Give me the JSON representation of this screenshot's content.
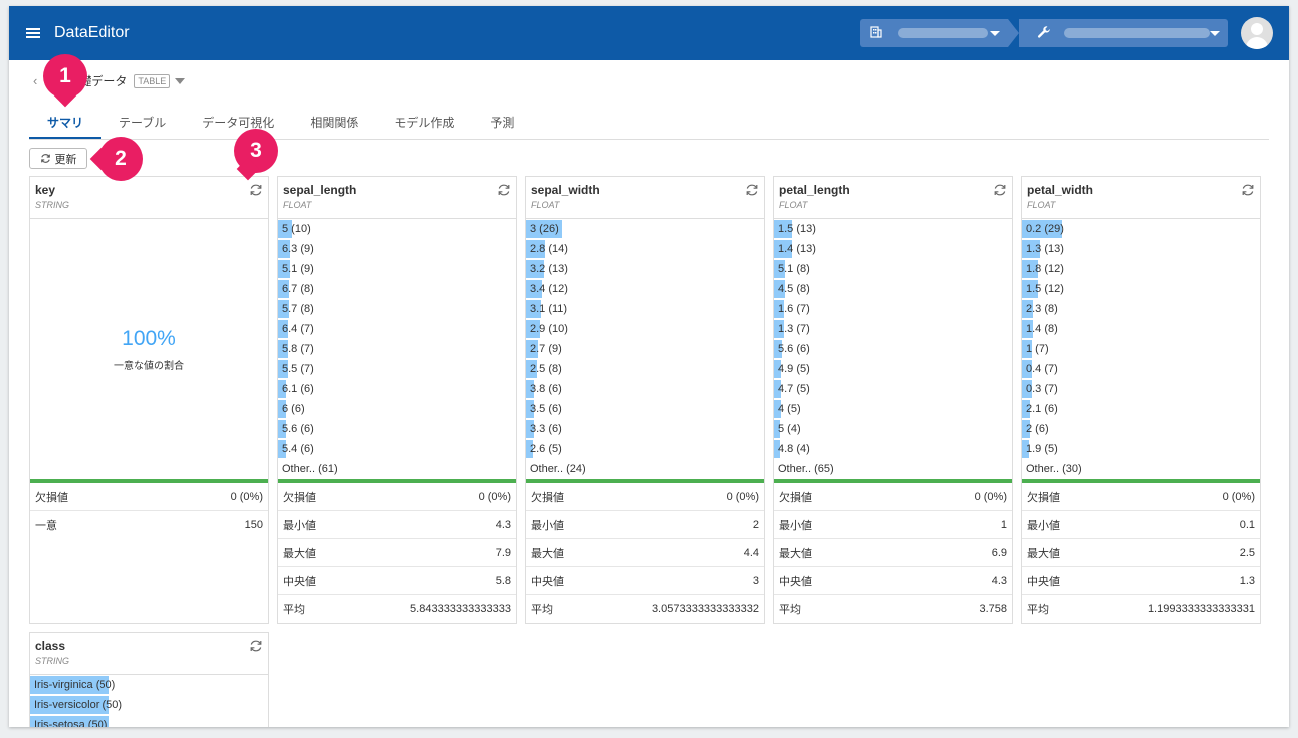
{
  "app": {
    "title": "DataEditor"
  },
  "breadcrumb": {
    "back": "‹",
    "table_name": "めの基礎データ",
    "badge": "TABLE"
  },
  "tabs": [
    "サマリ",
    "テーブル",
    "データ可視化",
    "相関関係",
    "モデル作成",
    "予測"
  ],
  "toolbar": {
    "refresh_label": "更新"
  },
  "markers": [
    "1",
    "2",
    "3"
  ],
  "key_card": {
    "name": "key",
    "type": "STRING",
    "unique_pct": "100%",
    "unique_label": "一意な値の割合",
    "stats": [
      {
        "label": "欠損値",
        "value": "0 (0%)"
      },
      {
        "label": "一意",
        "value": "150"
      }
    ]
  },
  "columns": [
    {
      "name": "sepal_length",
      "type": "FLOAT",
      "histogram": [
        {
          "label": "5 (10)",
          "frac": 0.34
        },
        {
          "label": "6.3 (9)",
          "frac": 0.31
        },
        {
          "label": "5.1 (9)",
          "frac": 0.31
        },
        {
          "label": "6.7 (8)",
          "frac": 0.28
        },
        {
          "label": "5.7 (8)",
          "frac": 0.28
        },
        {
          "label": "6.4 (7)",
          "frac": 0.24
        },
        {
          "label": "5.8 (7)",
          "frac": 0.24
        },
        {
          "label": "5.5 (7)",
          "frac": 0.24
        },
        {
          "label": "6.1 (6)",
          "frac": 0.21
        },
        {
          "label": "6 (6)",
          "frac": 0.21
        },
        {
          "label": "5.6 (6)",
          "frac": 0.21
        },
        {
          "label": "5.4 (6)",
          "frac": 0.21
        }
      ],
      "other": "Other.. (61)",
      "stats": [
        {
          "label": "欠損値",
          "value": "0 (0%)"
        },
        {
          "label": "最小値",
          "value": "4.3"
        },
        {
          "label": "最大値",
          "value": "7.9"
        },
        {
          "label": "中央値",
          "value": "5.8"
        },
        {
          "label": "平均",
          "value": "5.843333333333333"
        }
      ]
    },
    {
      "name": "sepal_width",
      "type": "FLOAT",
      "histogram": [
        {
          "label": "3 (26)",
          "frac": 0.9
        },
        {
          "label": "2.8 (14)",
          "frac": 0.48
        },
        {
          "label": "3.2 (13)",
          "frac": 0.45
        },
        {
          "label": "3.4 (12)",
          "frac": 0.41
        },
        {
          "label": "3.1 (11)",
          "frac": 0.38
        },
        {
          "label": "2.9 (10)",
          "frac": 0.34
        },
        {
          "label": "2.7 (9)",
          "frac": 0.31
        },
        {
          "label": "2.5 (8)",
          "frac": 0.28
        },
        {
          "label": "3.8 (6)",
          "frac": 0.21
        },
        {
          "label": "3.5 (6)",
          "frac": 0.21
        },
        {
          "label": "3.3 (6)",
          "frac": 0.21
        },
        {
          "label": "2.6 (5)",
          "frac": 0.17
        }
      ],
      "other": "Other.. (24)",
      "stats": [
        {
          "label": "欠損値",
          "value": "0 (0%)"
        },
        {
          "label": "最小値",
          "value": "2"
        },
        {
          "label": "最大値",
          "value": "4.4"
        },
        {
          "label": "中央値",
          "value": "3"
        },
        {
          "label": "平均",
          "value": "3.0573333333333332"
        }
      ]
    },
    {
      "name": "petal_length",
      "type": "FLOAT",
      "histogram": [
        {
          "label": "1.5 (13)",
          "frac": 0.45
        },
        {
          "label": "1.4 (13)",
          "frac": 0.45
        },
        {
          "label": "5.1 (8)",
          "frac": 0.28
        },
        {
          "label": "4.5 (8)",
          "frac": 0.28
        },
        {
          "label": "1.6 (7)",
          "frac": 0.24
        },
        {
          "label": "1.3 (7)",
          "frac": 0.24
        },
        {
          "label": "5.6 (6)",
          "frac": 0.21
        },
        {
          "label": "4.9 (5)",
          "frac": 0.17
        },
        {
          "label": "4.7 (5)",
          "frac": 0.17
        },
        {
          "label": "4 (5)",
          "frac": 0.17
        },
        {
          "label": "5 (4)",
          "frac": 0.14
        },
        {
          "label": "4.8 (4)",
          "frac": 0.14
        }
      ],
      "other": "Other.. (65)",
      "stats": [
        {
          "label": "欠損値",
          "value": "0 (0%)"
        },
        {
          "label": "最小値",
          "value": "1"
        },
        {
          "label": "最大値",
          "value": "6.9"
        },
        {
          "label": "中央値",
          "value": "4.3"
        },
        {
          "label": "平均",
          "value": "3.758"
        }
      ]
    },
    {
      "name": "petal_width",
      "type": "FLOAT",
      "histogram": [
        {
          "label": "0.2 (29)",
          "frac": 1.0
        },
        {
          "label": "1.3 (13)",
          "frac": 0.45
        },
        {
          "label": "1.8 (12)",
          "frac": 0.41
        },
        {
          "label": "1.5 (12)",
          "frac": 0.41
        },
        {
          "label": "2.3 (8)",
          "frac": 0.28
        },
        {
          "label": "1.4 (8)",
          "frac": 0.28
        },
        {
          "label": "1 (7)",
          "frac": 0.24
        },
        {
          "label": "0.4 (7)",
          "frac": 0.24
        },
        {
          "label": "0.3 (7)",
          "frac": 0.24
        },
        {
          "label": "2.1 (6)",
          "frac": 0.21
        },
        {
          "label": "2 (6)",
          "frac": 0.21
        },
        {
          "label": "1.9 (5)",
          "frac": 0.17
        }
      ],
      "other": "Other.. (30)",
      "stats": [
        {
          "label": "欠損値",
          "value": "0 (0%)"
        },
        {
          "label": "最小値",
          "value": "0.1"
        },
        {
          "label": "最大値",
          "value": "2.5"
        },
        {
          "label": "中央値",
          "value": "1.3"
        },
        {
          "label": "平均",
          "value": "1.1993333333333331"
        }
      ]
    }
  ],
  "class_card": {
    "name": "class",
    "type": "STRING",
    "histogram": [
      {
        "label": "Iris-virginica (50)",
        "frac": 0.33
      },
      {
        "label": "Iris-versicolor (50)",
        "frac": 0.33
      },
      {
        "label": "Iris-setosa (50)",
        "frac": 0.33
      }
    ]
  }
}
